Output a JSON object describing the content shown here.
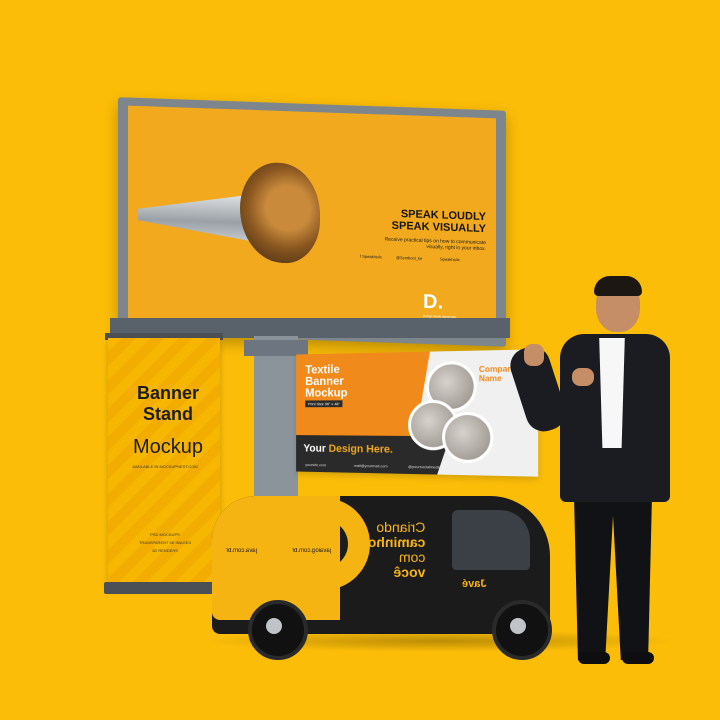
{
  "scene": {
    "background_color": "#fbbd08",
    "billboard": {
      "headline_1": "SPEAK LOUDLY",
      "headline_2": "SPEAK VISUALLY",
      "body": "Receive practical tips on how to communicate visually, right in your inbox.",
      "social_1": "f Speakhs4x",
      "social_2": "@Symbool_ke",
      "social_3": "Speakhs4x",
      "logo_mark": "D.",
      "logo_tag": "Design studio name here",
      "accent": "#f2a91d"
    },
    "banner_stand": {
      "title_line_1": "Banner",
      "title_line_2": "Stand",
      "title_line_3": "Mockup",
      "small_line": "AVAILABLE IN MOCKUPNEST.COM",
      "footer_1": "PSD MOCKUPS",
      "footer_2": "TRANSPARENT 4K IMAGES",
      "footer_3": "3D RENDERS"
    },
    "textile_banner": {
      "title_line_1": "Textile",
      "title_line_2": "Banner",
      "title_line_3": "Mockup",
      "size": "Print Size 96\" x 48\"",
      "company": "Company Name",
      "bottom_1": "Your ",
      "bottom_2": "Design Here.",
      "contact_1": "yoursite.com",
      "contact_2": "mail@yourmail.com",
      "contact_3": "@yoursocialmedia"
    },
    "van": {
      "text_line_1": "Criando",
      "text_line_2": "caminhos",
      "text_line_3": "com",
      "text_line_4": "você",
      "url_1": "java.com.br",
      "url_2": "javalog.com.br",
      "brand": "Javé"
    }
  }
}
